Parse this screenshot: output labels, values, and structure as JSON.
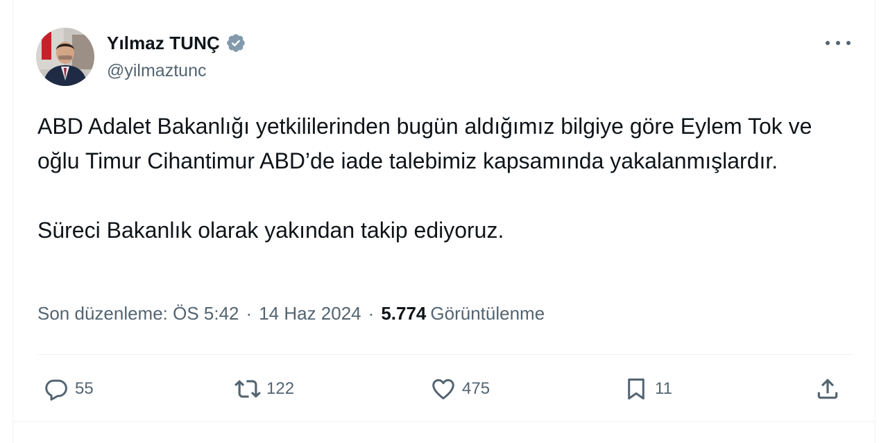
{
  "author": {
    "name": "Yılmaz TUNÇ",
    "handle": "@yilmaztunc",
    "verified_color": "#829aab"
  },
  "tweet": {
    "paragraphs": [
      "ABD Adalet Bakanlığı yetkililerinden bugün aldığımız bilgiye göre Eylem Tok ve oğlu Timur Cihantimur ABD’de iade talebimiz kapsamında yakalanmışlardır.",
      "Süreci Bakanlık olarak yakından takip ediyoruz."
    ],
    "edited_label": "Son düzenleme: ÖS 5:42",
    "date": "14 Haz 2024",
    "separator": "·",
    "views_count": "5.774",
    "views_label": "Görüntülenme"
  },
  "actions": {
    "replies": "55",
    "retweets": "122",
    "likes": "475",
    "bookmarks": "11"
  },
  "icons": {
    "more": "more-horizontal-icon",
    "reply": "reply-icon",
    "retweet": "retweet-icon",
    "like": "heart-icon",
    "bookmark": "bookmark-icon",
    "share": "share-icon"
  },
  "colors": {
    "text_primary": "#0f1419",
    "text_secondary": "#536471",
    "divider": "#eff3f4"
  }
}
